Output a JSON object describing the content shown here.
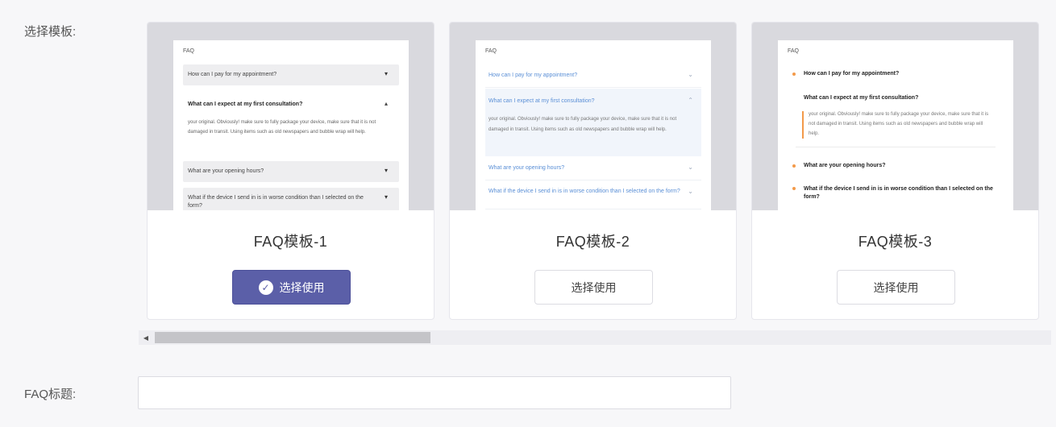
{
  "form": {
    "template_label": "选择模板:",
    "title_label": "FAQ标题:",
    "title_value": "",
    "title_placeholder": ""
  },
  "preview": {
    "heading": "FAQ",
    "questions": [
      "How can I pay for my appointment?",
      "What can I expect at my first consultation?",
      "What are your opening hours?",
      "What if the device I send in is in worse condition than I selected on the form?"
    ],
    "answer": "your original. Obviously! make sure to fully package your device, make sure that it is not damaged in transit. Using items such as old newspapers and bubble wrap will help."
  },
  "templates": [
    {
      "name": "FAQ模板-1",
      "button_label": "选择使用",
      "selected": true
    },
    {
      "name": "FAQ模板-2",
      "button_label": "选择使用",
      "selected": false
    },
    {
      "name": "FAQ模板-3",
      "button_label": "选择使用",
      "selected": false
    }
  ],
  "icons": {
    "check": "check-circle-icon",
    "scroll_left": "caret-left-icon",
    "expand": "caret-down-icon",
    "collapse": "caret-up-icon"
  },
  "colors": {
    "accent": "#5b5fa8",
    "link_blue": "#5a8fd6",
    "orange_marker": "#f39a4a"
  }
}
